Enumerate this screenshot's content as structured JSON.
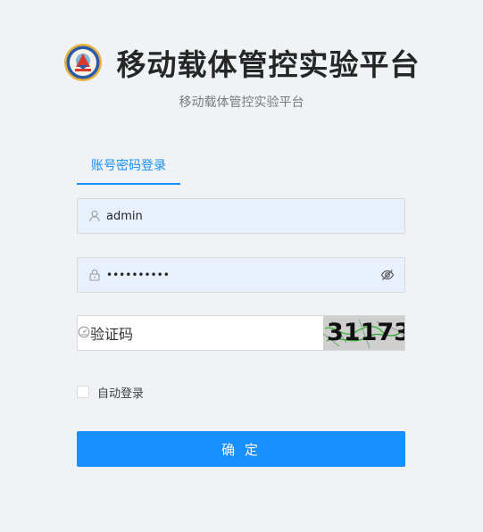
{
  "header": {
    "title": "移动载体管控实验平台",
    "subtitle": "移动载体管控实验平台",
    "logo_icon": "badge-logo-icon"
  },
  "tabs": [
    {
      "label": "账号密码登录",
      "active": true
    }
  ],
  "form": {
    "username": {
      "value": "admin",
      "icon": "user-icon"
    },
    "password": {
      "value": "••••••••••",
      "icon": "lock-icon",
      "toggle_icon": "eye-invisible-icon"
    },
    "captcha": {
      "placeholder": "验证码",
      "icon": "dashboard-icon",
      "image_text": "31173"
    },
    "remember": {
      "label": "自动登录",
      "checked": false
    },
    "submit_label": "确 定"
  },
  "colors": {
    "background": "#f0f2f5",
    "primary": "#1890ff",
    "autofill_bg": "#e8f0fe",
    "title": "#262626"
  }
}
